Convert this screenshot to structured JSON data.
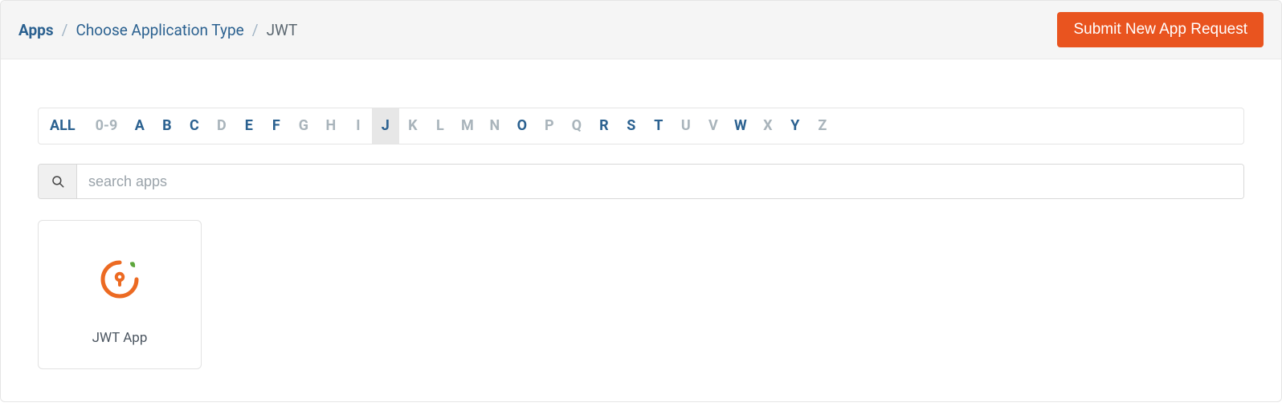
{
  "breadcrumb": {
    "root": "Apps",
    "second": "Choose Application Type",
    "current": "JWT"
  },
  "submit_btn": "Submit New App Request",
  "alpha": {
    "all": "ALL",
    "tabs": [
      {
        "label": "0-9",
        "enabled": false,
        "active": false
      },
      {
        "label": "A",
        "enabled": true,
        "active": false
      },
      {
        "label": "B",
        "enabled": true,
        "active": false
      },
      {
        "label": "C",
        "enabled": true,
        "active": false
      },
      {
        "label": "D",
        "enabled": false,
        "active": false
      },
      {
        "label": "E",
        "enabled": true,
        "active": false
      },
      {
        "label": "F",
        "enabled": true,
        "active": false
      },
      {
        "label": "G",
        "enabled": false,
        "active": false
      },
      {
        "label": "H",
        "enabled": false,
        "active": false
      },
      {
        "label": "I",
        "enabled": false,
        "active": false
      },
      {
        "label": "J",
        "enabled": true,
        "active": true
      },
      {
        "label": "K",
        "enabled": false,
        "active": false
      },
      {
        "label": "L",
        "enabled": false,
        "active": false
      },
      {
        "label": "M",
        "enabled": false,
        "active": false
      },
      {
        "label": "N",
        "enabled": false,
        "active": false
      },
      {
        "label": "O",
        "enabled": true,
        "active": false
      },
      {
        "label": "P",
        "enabled": false,
        "active": false
      },
      {
        "label": "Q",
        "enabled": false,
        "active": false
      },
      {
        "label": "R",
        "enabled": true,
        "active": false
      },
      {
        "label": "S",
        "enabled": true,
        "active": false
      },
      {
        "label": "T",
        "enabled": true,
        "active": false
      },
      {
        "label": "U",
        "enabled": false,
        "active": false
      },
      {
        "label": "V",
        "enabled": false,
        "active": false
      },
      {
        "label": "W",
        "enabled": true,
        "active": false
      },
      {
        "label": "X",
        "enabled": false,
        "active": false
      },
      {
        "label": "Y",
        "enabled": true,
        "active": false
      },
      {
        "label": "Z",
        "enabled": false,
        "active": false
      }
    ]
  },
  "search": {
    "placeholder": "search apps",
    "value": ""
  },
  "apps": [
    {
      "name": "JWT App",
      "accent": "#ec6a22",
      "leaf": "#5da63c"
    }
  ]
}
